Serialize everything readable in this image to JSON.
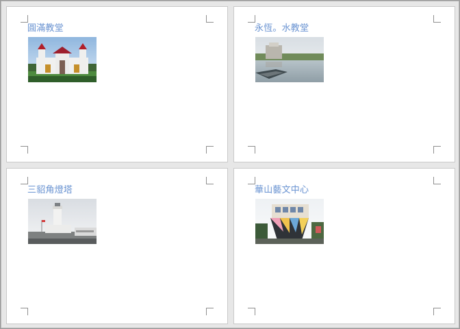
{
  "pages": [
    {
      "title": "圓滿教堂",
      "image": "church-photo"
    },
    {
      "title": "永恆。水教堂",
      "image": "water-church-photo"
    },
    {
      "title": "三貂角燈塔",
      "image": "lighthouse-photo"
    },
    {
      "title": "華山藝文中心",
      "image": "upside-down-house-photo"
    }
  ]
}
